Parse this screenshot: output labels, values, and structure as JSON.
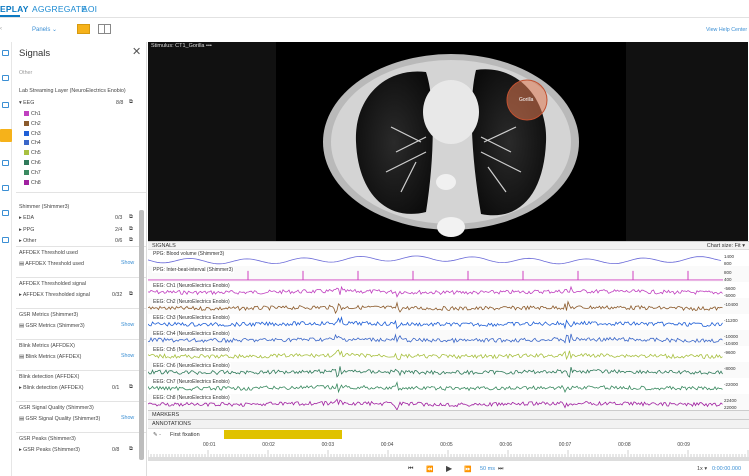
{
  "nav": {
    "tabs": [
      {
        "label": "EPLAY"
      },
      {
        "label": "AGGREGATE"
      },
      {
        "label": "AOI"
      }
    ]
  },
  "toolbar": {
    "panels_label": "Panels",
    "help_label": "View Help Center"
  },
  "signals_panel": {
    "title": "Signals",
    "top_cut_label": "Other",
    "lsl_header": "Lab Streaming Layer (NeuroElectrics Enobio)",
    "eeg": {
      "label": "EEG",
      "count": "8/8",
      "channels": [
        {
          "label": "Ch1",
          "color": "#c040c0"
        },
        {
          "label": "Ch2",
          "color": "#8b5a2b"
        },
        {
          "label": "Ch3",
          "color": "#1f5fd6"
        },
        {
          "label": "Ch4",
          "color": "#3a66c8"
        },
        {
          "label": "Ch5",
          "color": "#a8c040"
        },
        {
          "label": "Ch6",
          "color": "#2f7a5a"
        },
        {
          "label": "Ch7",
          "color": "#3a8a60"
        },
        {
          "label": "Ch8",
          "color": "#a020a0"
        }
      ]
    },
    "shimmer_header": "Shimmer (Shimmer3)",
    "shimmer_items": [
      {
        "label": "EDA",
        "count": "0/3"
      },
      {
        "label": "PPG",
        "count": "2/4"
      },
      {
        "label": "Other",
        "count": "0/6"
      }
    ],
    "sections": [
      {
        "header": "AFFDEX Threshold used",
        "item": "AFFDEX Threshold used",
        "action": "Show"
      },
      {
        "header": "AFFDEX Thresholded signal",
        "item": "AFFDEX Thresholded signal",
        "count": "0/32"
      },
      {
        "header": "GSR Metrics (Shimmer3)",
        "item": "GSR Metrics (Shimmer3)",
        "action": "Show"
      },
      {
        "header": "Blink Metrics (AFFDEX)",
        "item": "Blink Metrics (AFFDEX)",
        "action": "Show"
      },
      {
        "header": "Blink detection (AFFDEX)",
        "item": "Blink detection (AFFDEX)",
        "count": "0/1"
      },
      {
        "header": "GSR Signal Quality (Shimmer3)",
        "item": "GSR Signal Quality (Shimmer3)",
        "action": "Show"
      },
      {
        "header": "GSR Peaks (Shimmer3)",
        "item": "GSR Peaks (Shimmer3)",
        "count": "0/8"
      }
    ]
  },
  "stimulus": {
    "label": "Stimulus: CT1_Gorilla",
    "aoi_label": "Gorilla"
  },
  "signals_view": {
    "header": "SIGNALS",
    "chart_size_label": "Chart size:",
    "chart_size_value": "Fit",
    "rows": [
      {
        "label": "PPG: Blood volume (Shimmer3)",
        "color": "#6a6ad8",
        "vals": [
          "1400",
          "800"
        ]
      },
      {
        "label": "PPG: Inter-beat-interval (Shimmer3)",
        "color": "#d040c0",
        "vals": [
          "800",
          "400"
        ]
      },
      {
        "label": "EEG: Ch1 (NeuroElectrics Enobio)",
        "color": "#c040c0",
        "vals": [
          "-5600",
          "-5000"
        ]
      },
      {
        "label": "EEG: Ch2 (NeuroElectrics Enobio)",
        "color": "#8b5a2b",
        "vals": [
          "-10400"
        ]
      },
      {
        "label": "EEG: Ch3 (NeuroElectrics Enobio)",
        "color": "#1f5fd6",
        "vals": [
          "-11200"
        ]
      },
      {
        "label": "EEG: Ch4 (NeuroElectrics Enobio)",
        "color": "#3a66c8",
        "vals": [
          "-10000",
          "-10400"
        ]
      },
      {
        "label": "EEG: Ch5 (NeuroElectrics Enobio)",
        "color": "#a8c040",
        "vals": [
          "-9600"
        ]
      },
      {
        "label": "EEG: Ch6 (NeuroElectrics Enobio)",
        "color": "#2f7a5a",
        "vals": [
          "-8000"
        ]
      },
      {
        "label": "EEG: Ch7 (NeuroElectrics Enobio)",
        "color": "#3a8a60",
        "vals": [
          "-22000"
        ]
      },
      {
        "label": "EEG: Ch8 (NeuroElectrics Enobio)",
        "color": "#a020a0",
        "vals": [
          "22400",
          "22000"
        ]
      }
    ]
  },
  "markers": {
    "header": "MARKERS"
  },
  "annotations": {
    "header": "ANNOTATIONS",
    "item": "First fixation"
  },
  "timeline": {
    "ticks": [
      "00:01",
      "00:02",
      "00:03",
      "00:04",
      "00:05",
      "00:06",
      "00:07",
      "00:08",
      "00:09"
    ]
  },
  "playback": {
    "step": "50 ms",
    "speed": "1x",
    "time": "0:00:00.000"
  },
  "colors": {
    "accent": "#0b79c2",
    "selected": "#f6b21a",
    "annotation": "#e0c200"
  }
}
